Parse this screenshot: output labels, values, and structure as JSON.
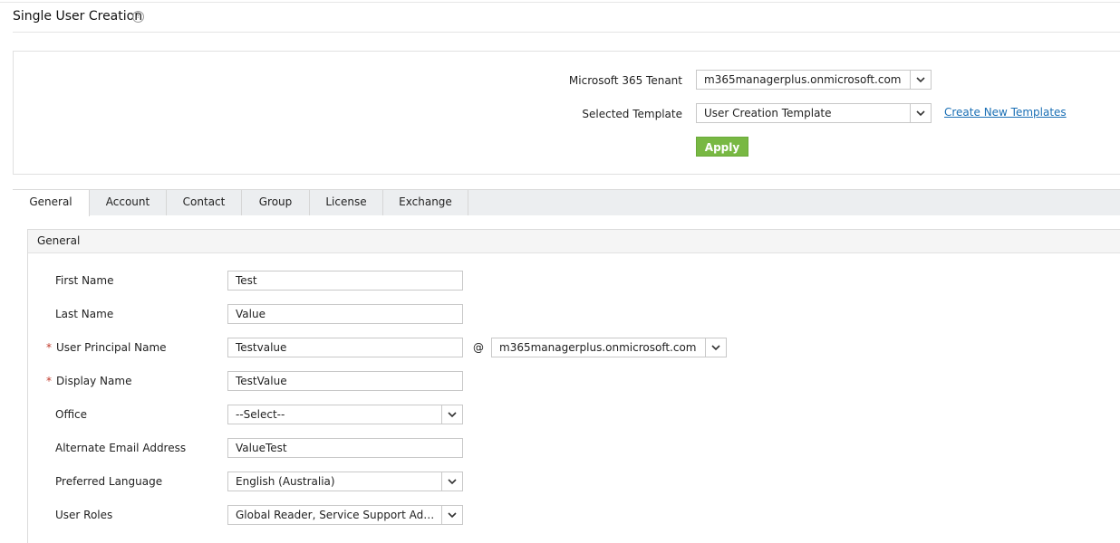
{
  "page": {
    "title": "Single User Creation",
    "help_glyph": "?"
  },
  "config": {
    "tenant_label": "Microsoft 365 Tenant",
    "tenant_value": "m365managerplus.onmicrosoft.com",
    "template_label": "Selected Template",
    "template_value": "User Creation Template",
    "create_templates_link": "Create New Templates",
    "apply_label": "Apply"
  },
  "tabs": [
    {
      "label": "General"
    },
    {
      "label": "Account"
    },
    {
      "label": "Contact"
    },
    {
      "label": "Group"
    },
    {
      "label": "License"
    },
    {
      "label": "Exchange"
    }
  ],
  "active_tab": "General",
  "section": {
    "title": "General"
  },
  "fields": {
    "first_name": {
      "label": "First Name",
      "value": "Test"
    },
    "last_name": {
      "label": "Last Name",
      "value": "Value"
    },
    "upn": {
      "label": "User Principal Name",
      "value": "Testvalue",
      "at": "@",
      "domain": "m365managerplus.onmicrosoft.com",
      "required_mark": "*"
    },
    "display_name": {
      "label": "Display Name",
      "value": "TestValue",
      "required_mark": "*"
    },
    "office": {
      "label": "Office",
      "value": "--Select--"
    },
    "alt_email": {
      "label": "Alternate Email Address",
      "value": "ValueTest"
    },
    "language": {
      "label": "Preferred Language",
      "value": "English (Australia)"
    },
    "roles": {
      "label": "User Roles",
      "value": "Global Reader, Service Support Administrator"
    }
  },
  "colors": {
    "accent_button": "#78b843",
    "link": "#1a6fb5",
    "required": "#c0392b"
  },
  "icons": {
    "help": "help-circle-icon",
    "dropdown": "chevron-down-icon"
  }
}
